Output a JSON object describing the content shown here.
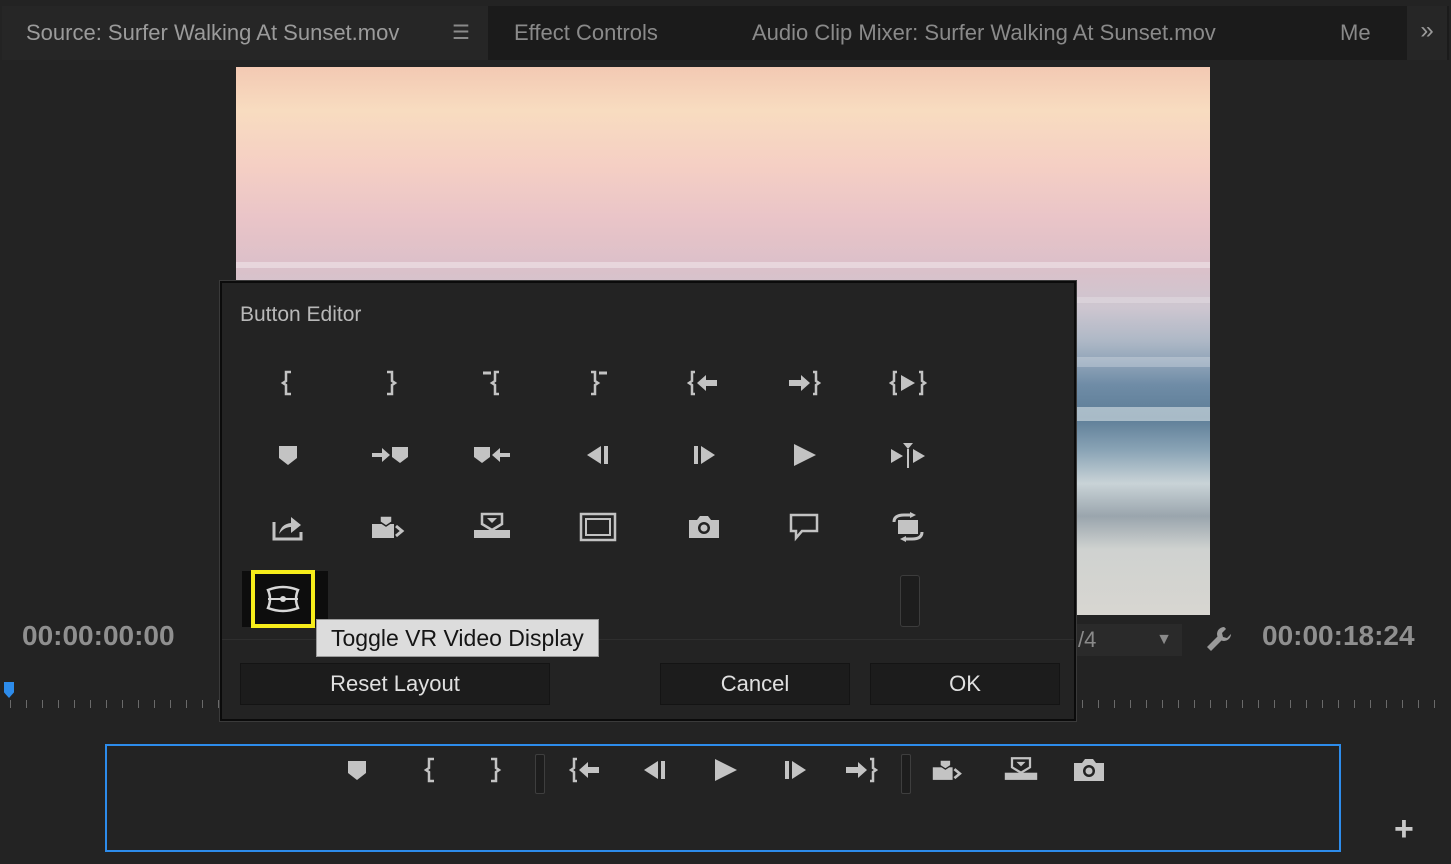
{
  "tabs": {
    "source": "Source: Surfer Walking At Sunset.mov",
    "menu_icon": "hamburger-menu-icon",
    "effect_controls": "Effect Controls",
    "audio_clip_mixer": "Audio Clip Mixer: Surfer Walking At Sunset.mov",
    "truncated": "Me",
    "overflow_icon": "double-chevron-right-icon"
  },
  "monitor": {
    "timecode_in": "00:00:00:00",
    "timecode_out": "00:00:18:24",
    "resolution_partial": "/4",
    "settings_icon": "wrench-icon"
  },
  "button_editor": {
    "title": "Button Editor",
    "rows": [
      [
        "mark-in-icon",
        "mark-out-icon",
        "clear-in-icon",
        "clear-out-icon",
        "go-to-in-icon",
        "go-to-out-icon",
        "play-in-to-out-icon"
      ],
      [
        "add-marker-icon",
        "go-to-next-marker-icon",
        "go-to-previous-marker-icon",
        "step-back-icon",
        "step-forward-icon",
        "play-icon",
        "play-around-icon"
      ],
      [
        "export-frame-share-icon",
        "insert-icon",
        "overwrite-icon",
        "safe-margins-icon",
        "camera-icon",
        "comment-icon",
        "loop-icon"
      ]
    ],
    "highlighted_button": "vr-video-icon",
    "tooltip": "Toggle VR Video Display",
    "reset_label": "Reset Layout",
    "cancel_label": "Cancel",
    "ok_label": "OK"
  },
  "transport": {
    "buttons": [
      "add-marker-icon",
      "mark-in-icon",
      "mark-out-icon",
      "separator",
      "go-to-in-icon",
      "step-back-icon",
      "play-icon",
      "step-forward-icon",
      "go-to-out-icon",
      "separator",
      "insert-icon",
      "overwrite-icon",
      "camera-icon"
    ],
    "add_button": "+"
  },
  "colors": {
    "accent_blue": "#2d8ceb",
    "highlight_yellow": "#f6ec1a",
    "panel_bg": "#232323"
  }
}
